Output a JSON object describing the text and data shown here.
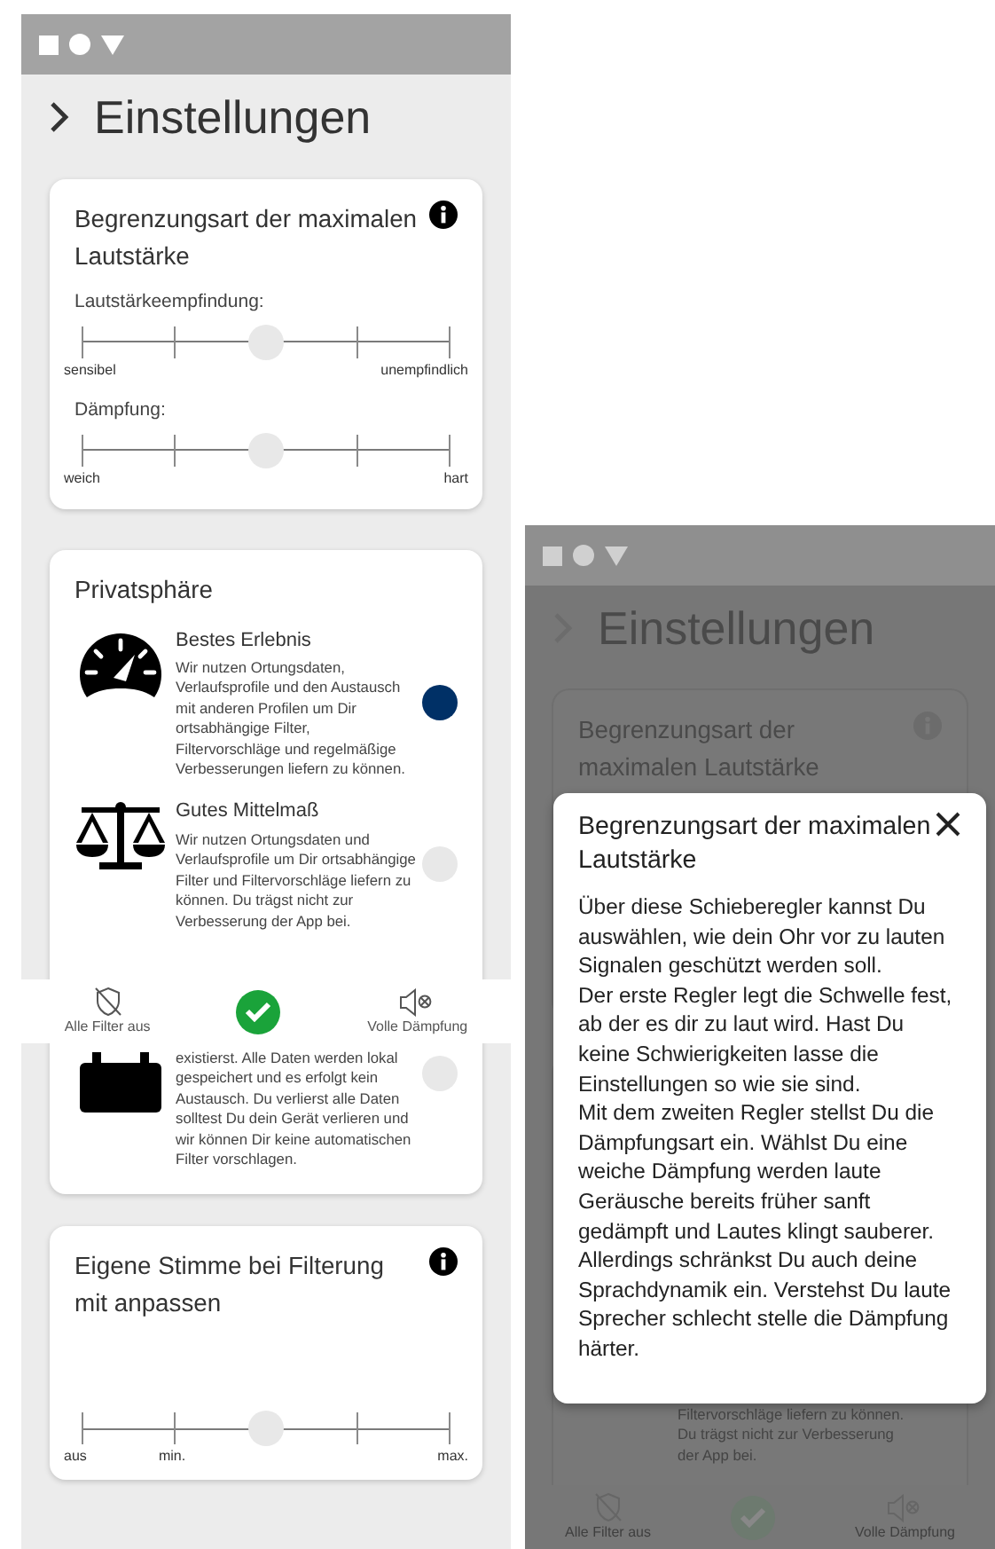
{
  "left_screen": {
    "header": {
      "title": "Einstellungen"
    },
    "cards": [
      {
        "kind": "sliders",
        "title": "Begrenzungsart der maximalen Lautstärke",
        "sliders": [
          {
            "label": "Lautstärkeempfindung:",
            "level": 0.5,
            "labels": {
              "start": "sensibel",
              "end": "unempfindlich"
            }
          },
          {
            "label": "Dämpfung:",
            "level": 0.5,
            "labels": {
              "start": "weich",
              "end": "hart"
            }
          }
        ]
      },
      {
        "kind": "options",
        "title": "Privatsphäre",
        "options": [
          {
            "title": "Bestes Erlebnis",
            "text": "Wir nutzen Ortungsdaten, Verlaufsprofile und den Austausch mit anderen Profilen um Dir ortsabhängige Filter, Filtervorschläge und regelmäßige Verbesserungen liefern zu können.",
            "selected": true
          },
          {
            "title": "Gutes Mittelmaß",
            "text": "Wir nutzen Ortungsdaten und Verlaufsprofile um Dir ortsabhängige Filter und Filtervorschläge liefern zu können. Du trägst nicht zur Verbesserung der App bei.",
            "selected": false
          },
          {
            "text": "existierst. Alle Daten werden lokal gespeichert und es erfolgt kein Austausch. Du verlierst alle Daten solltest Du dein Gerät verlieren und wir können Dir keine automatischen Filter vorschlagen.",
            "selected": false
          }
        ]
      },
      {
        "kind": "sliders",
        "title": "Eigene Stimme bei Filterung mit anpassen",
        "sliders": [
          {
            "level": 0.5,
            "labels": {
              "start": "aus",
              "quarter": "min.",
              "end": "max."
            }
          }
        ]
      }
    ],
    "bottom_bar": {
      "left_action": "Alle Filter aus",
      "right_action": "Volle Dämpfung"
    }
  },
  "right_screen": {
    "header": {
      "title": "Einstellungen"
    },
    "card_title": "Begrenzungsart der maximalen Lautstärke",
    "dialog": {
      "title": "Begrenzungsart der maximalen Lautstärke",
      "paragraphs": [
        "Über diese Schieberegler kannst Du auswählen, wie dein Ohr vor zu lauten Signalen geschützt werden soll.",
        "Der erste Regler legt die Schwelle fest, ab der es dir zu laut wird. Hast Du keine Schwierigkeiten lasse die Einstellungen so wie sie sind.",
        "Mit dem zweiten Regler stellst Du die Dämpfungsart ein. Wählst Du eine weiche Dämpfung werden laute Geräusche bereits früher sanft gedämpft und Lautes klingt sauberer. Allerdings schränkst Du auch deine Sprachdynamik ein. Verstehst Du laute Sprecher schlecht stelle die Dämpfung härter."
      ]
    },
    "behind_text": "Filtervorschläge liefern zu können. Du trägst nicht zur Verbesserung der App bei.",
    "bottom_bar": {
      "left_action": "Alle Filter aus",
      "right_action": "Volle Dämpfung"
    }
  }
}
